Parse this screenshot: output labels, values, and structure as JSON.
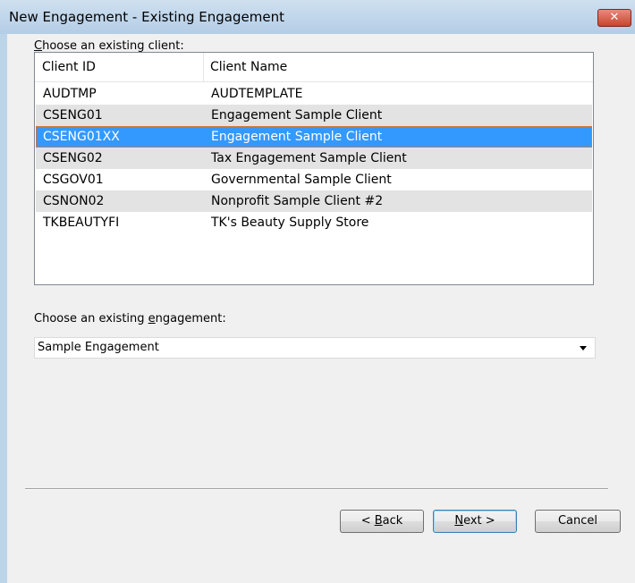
{
  "window": {
    "title": "New Engagement - Existing Engagement",
    "close_glyph": "✕"
  },
  "client_section": {
    "label_prefix": "",
    "label_accel": "C",
    "label_rest": "hoose an existing client:"
  },
  "client_list": {
    "columns": [
      "Client ID",
      "Client Name"
    ],
    "rows": [
      {
        "id": "AUDTMP",
        "name": "AUDTEMPLATE"
      },
      {
        "id": "CSENG01",
        "name": "Engagement Sample Client"
      },
      {
        "id": "CSENG01XX",
        "name": "Engagement Sample Client"
      },
      {
        "id": "CSENG02",
        "name": "Tax Engagement Sample Client"
      },
      {
        "id": "CSGOV01",
        "name": "Governmental Sample Client"
      },
      {
        "id": "CSNON02",
        "name": "Nonprofit Sample Client #2"
      },
      {
        "id": "TKBEAUTYFI",
        "name": "TK's Beauty Supply Store"
      }
    ],
    "selected_index": 2
  },
  "engagement_section": {
    "label_prefix": "Choose an existing ",
    "label_accel": "e",
    "label_rest": "ngagement:",
    "selected_value": "Sample Engagement"
  },
  "buttons": {
    "back_prefix": "< ",
    "back_accel": "B",
    "back_rest": "ack",
    "next_prefix": "",
    "next_accel": "N",
    "next_rest": "ext >",
    "cancel_label": "Cancel"
  },
  "colors": {
    "selection": "#3399ff",
    "selection_border": "#d07a3a",
    "alt_row": "#e3e3e3",
    "titlebar": "#b9d1ea",
    "close_button": "#c8442e"
  }
}
